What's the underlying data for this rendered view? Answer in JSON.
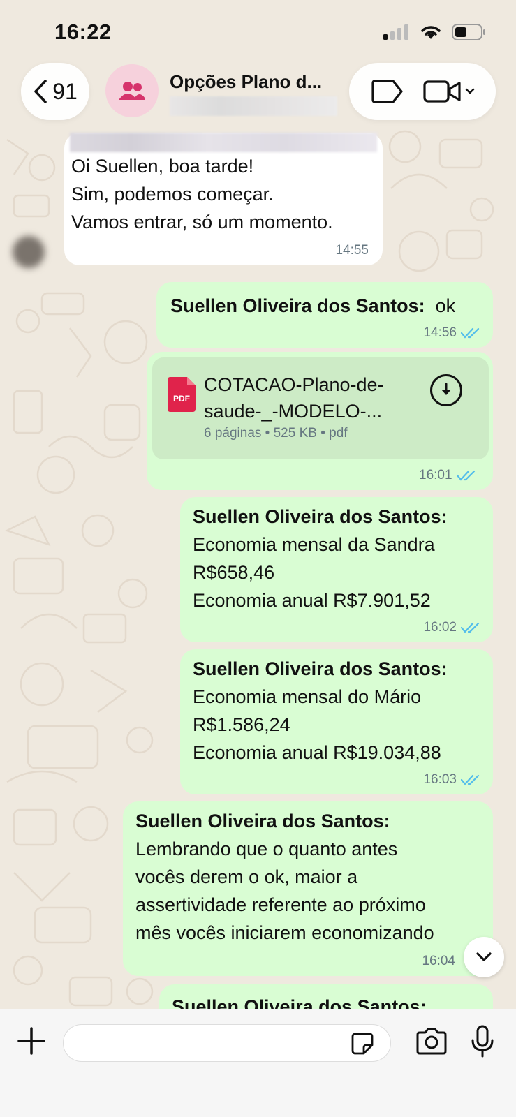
{
  "status_bar": {
    "time": "16:22"
  },
  "header": {
    "back_count": "91",
    "chat_title": "Opções Plano d..."
  },
  "messages": [
    {
      "type": "incoming",
      "lines": [
        "Oi Suellen, boa tarde!",
        "Sim, podemos começar.",
        "Vamos entrar, só um momento."
      ],
      "time": "14:55"
    },
    {
      "type": "outgoing",
      "sender": "Suellen Oliveira dos Santos:",
      "text": "ok",
      "time": "14:56"
    },
    {
      "type": "document",
      "name_lines": [
        "COTACAO-Plano-de-",
        "saude-_-MODELO-..."
      ],
      "meta": "6 páginas • 525 KB • pdf",
      "badge": "PDF",
      "time": "16:01"
    },
    {
      "type": "outgoing",
      "sender": "Suellen Oliveira dos Santos:",
      "lines": [
        "Economia mensal da Sandra",
        "R$658,46",
        "Economia anual R$7.901,52"
      ],
      "time": "16:02"
    },
    {
      "type": "outgoing",
      "sender": "Suellen Oliveira dos Santos:",
      "lines": [
        "Economia mensal do Mário",
        "R$1.586,24",
        "Economia anual R$19.034,88"
      ],
      "time": "16:03"
    },
    {
      "type": "outgoing",
      "sender": "Suellen Oliveira dos Santos:",
      "lines": [
        "Lembrando que o quanto antes",
        "vocês derem o ok, maior a",
        "assertividade referente ao próximo",
        "mês vocês iniciarem economizando"
      ],
      "time": "16:04"
    },
    {
      "type": "outgoing",
      "sender": "Suellen Oliveira dos Santos:"
    }
  ],
  "composer": {
    "value": ""
  },
  "colors": {
    "outgoing_bubble": "#d9fdd3",
    "incoming_bubble": "#ffffff",
    "read_ticks": "#53bdeb",
    "wallpaper": "#efe9df"
  }
}
